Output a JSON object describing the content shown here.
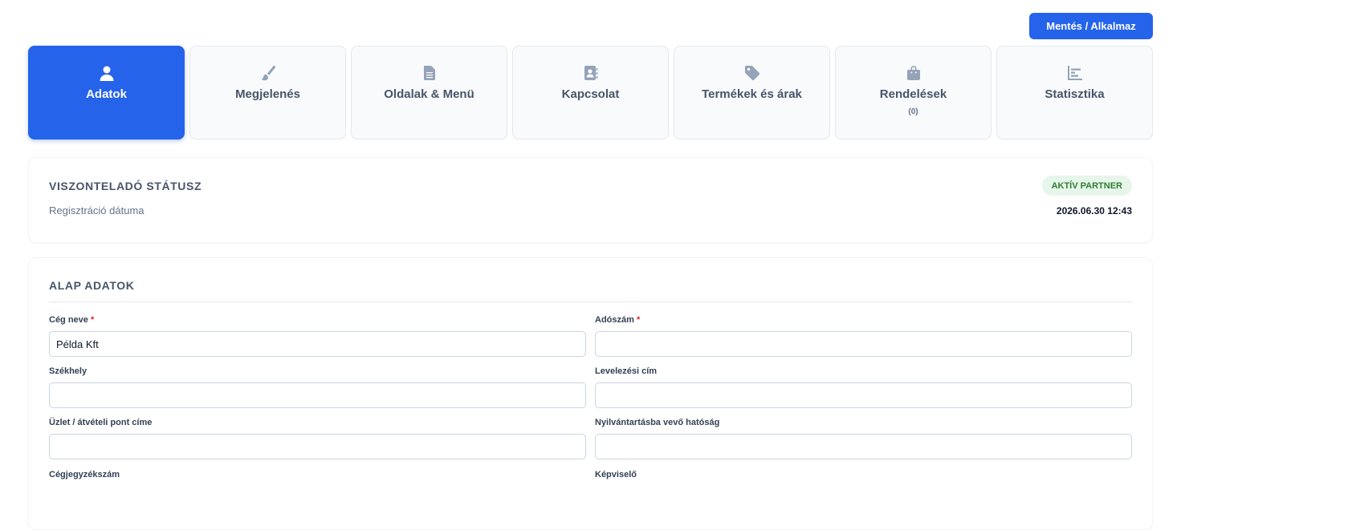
{
  "toolbar": {
    "save_label": "Mentés / Alkalmaz"
  },
  "tabs": [
    {
      "label": "Adatok",
      "icon": "user-icon",
      "active": true
    },
    {
      "label": "Megjelenés",
      "icon": "paintbrush-icon"
    },
    {
      "label": "Oldalak & Menü",
      "icon": "document-icon"
    },
    {
      "label": "Kapcsolat",
      "icon": "address-book-icon"
    },
    {
      "label": "Termékek és árak",
      "icon": "tag-icon"
    },
    {
      "label": "Rendelések",
      "icon": "shopping-bag-icon",
      "count": "(0)"
    },
    {
      "label": "Statisztika",
      "icon": "bar-chart-icon"
    }
  ],
  "status": {
    "title": "VISZONTELADÓ STÁTUSZ",
    "badge": "AKTÍV PARTNER",
    "badge_color": "#2e7d32",
    "reg_label": "Regisztráció dátuma",
    "reg_date": "2026.06.30 12:43"
  },
  "form": {
    "title": "ALAP ADATOK",
    "fields": {
      "company_name": {
        "label": "Cég neve",
        "required": "*",
        "value": "Példa Kft"
      },
      "tax_number": {
        "label": "Adószám",
        "required": "*",
        "value": ""
      },
      "headquarters": {
        "label": "Székhely",
        "value": ""
      },
      "mailing_address": {
        "label": "Levelezési cím",
        "value": ""
      },
      "shop_address": {
        "label": "Üzlet / átvételi pont címe",
        "value": ""
      },
      "registering_authority": {
        "label": "Nyilvántartásba vevő hatóság",
        "value": ""
      },
      "registry_number": {
        "label": "Cégjegyzékszám"
      },
      "representative": {
        "label": "Képviselő"
      }
    }
  },
  "colors": {
    "accent": "#2563eb",
    "tab_bg": "#f8fafc"
  }
}
